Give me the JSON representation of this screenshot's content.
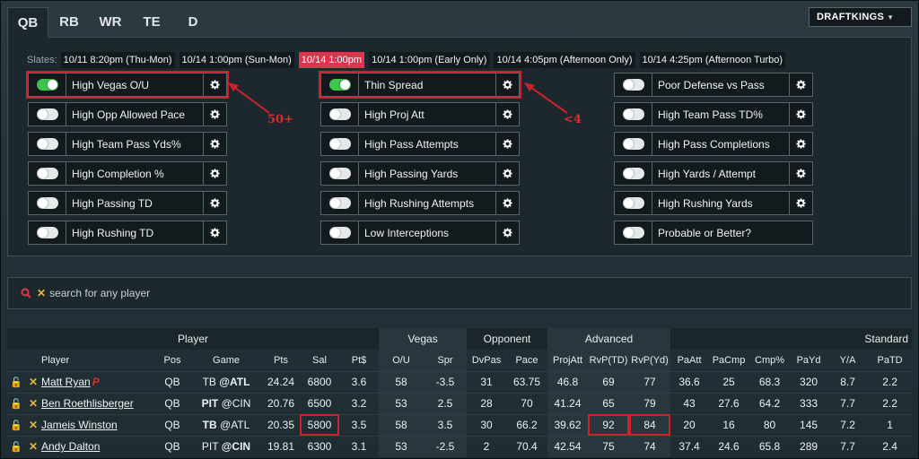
{
  "tabs": [
    "QB",
    "RB",
    "WR",
    "TE",
    "D"
  ],
  "site_button": "DRAFTKINGS",
  "slates_label": "Slates:",
  "slates": [
    "10/11 8:20pm (Thu-Mon)",
    "10/14 1:00pm (Sun-Mon)",
    "10/14 1:00pm",
    "10/14 1:00pm (Early Only)",
    "10/14 4:05pm (Afternoon Only)",
    "10/14 4:25pm (Afternoon Turbo)"
  ],
  "filters_col1": [
    "High Vegas O/U",
    "High Opp Allowed Pace",
    "High Team Pass Yds%",
    "High Completion %",
    "High Passing TD",
    "High Rushing TD"
  ],
  "filters_col2": [
    "Thin Spread",
    "High Proj Att",
    "High Pass Attempts",
    "High Passing Yards",
    "High Rushing Attempts",
    "Low Interceptions"
  ],
  "filters_col3": [
    "Poor Defense vs Pass",
    "High Team Pass TD%",
    "High Pass Completions",
    "High Yards / Attempt",
    "High Rushing Yards",
    "Probable or Better?"
  ],
  "annotations": {
    "a1": "50+",
    "a2": "<4"
  },
  "search_placeholder": "search for any player",
  "groups": {
    "player": "Player",
    "vegas": "Vegas",
    "opponent": "Opponent",
    "advanced": "Advanced",
    "standard": "Standard"
  },
  "columns": [
    "Player",
    "Pos",
    "Game",
    "Pts",
    "Sal",
    "Pt$",
    "O/U",
    "Spr",
    "DvPas",
    "Pace",
    "ProjAtt",
    "RvP(TD)",
    "RvP(Yd)",
    "PaAtt",
    "PaCmp",
    "Cmp%",
    "PaYd",
    "Y/A",
    "PaTD"
  ],
  "rows": [
    {
      "player": "Matt Ryan",
      "flag": "P",
      "pos": "QB",
      "team": "TB",
      "at": "@ATL",
      "bold": "at",
      "pts": "24.24",
      "sal": "6800",
      "ptd": "3.6",
      "ou": "58",
      "spr": "-3.5",
      "dvpas": "31",
      "pace": "63.75",
      "projatt": "46.8",
      "rvptd": "69",
      "rvpyd": "77",
      "paatt": "36.6",
      "pacmp": "25",
      "cmp": "68.3",
      "payd": "320",
      "ya": "8.7",
      "patd": "2.2"
    },
    {
      "player": "Ben Roethlisberger",
      "flag": "",
      "pos": "QB",
      "team": "PIT",
      "at": "@CIN",
      "bold": "team",
      "pts": "20.76",
      "sal": "6500",
      "ptd": "3.2",
      "ou": "53",
      "spr": "2.5",
      "dvpas": "28",
      "pace": "70",
      "projatt": "41.24",
      "rvptd": "65",
      "rvpyd": "79",
      "paatt": "43",
      "pacmp": "27.6",
      "cmp": "64.2",
      "payd": "333",
      "ya": "7.7",
      "patd": "2.2"
    },
    {
      "player": "Jameis Winston",
      "flag": "",
      "pos": "QB",
      "team": "TB",
      "at": "@ATL",
      "bold": "team",
      "pts": "20.35",
      "sal": "5800",
      "ptd": "3.5",
      "ou": "58",
      "spr": "3.5",
      "dvpas": "30",
      "pace": "66.2",
      "projatt": "39.62",
      "rvptd": "92",
      "rvpyd": "84",
      "paatt": "20",
      "pacmp": "16",
      "cmp": "80",
      "payd": "145",
      "ya": "7.2",
      "patd": "1"
    },
    {
      "player": "Andy Dalton",
      "flag": "",
      "pos": "QB",
      "team": "PIT",
      "at": "@CIN",
      "bold": "at",
      "pts": "19.81",
      "sal": "6300",
      "ptd": "3.1",
      "ou": "53",
      "spr": "-2.5",
      "dvpas": "2",
      "pace": "70.4",
      "projatt": "42.54",
      "rvptd": "75",
      "rvpyd": "74",
      "paatt": "37.4",
      "pacmp": "24.6",
      "cmp": "65.8",
      "payd": "289",
      "ya": "7.7",
      "patd": "2.4"
    }
  ],
  "colors": {
    "accent_red": "#e0344e",
    "toggle_on": "#3fc44f",
    "annotation": "#d0202a"
  }
}
